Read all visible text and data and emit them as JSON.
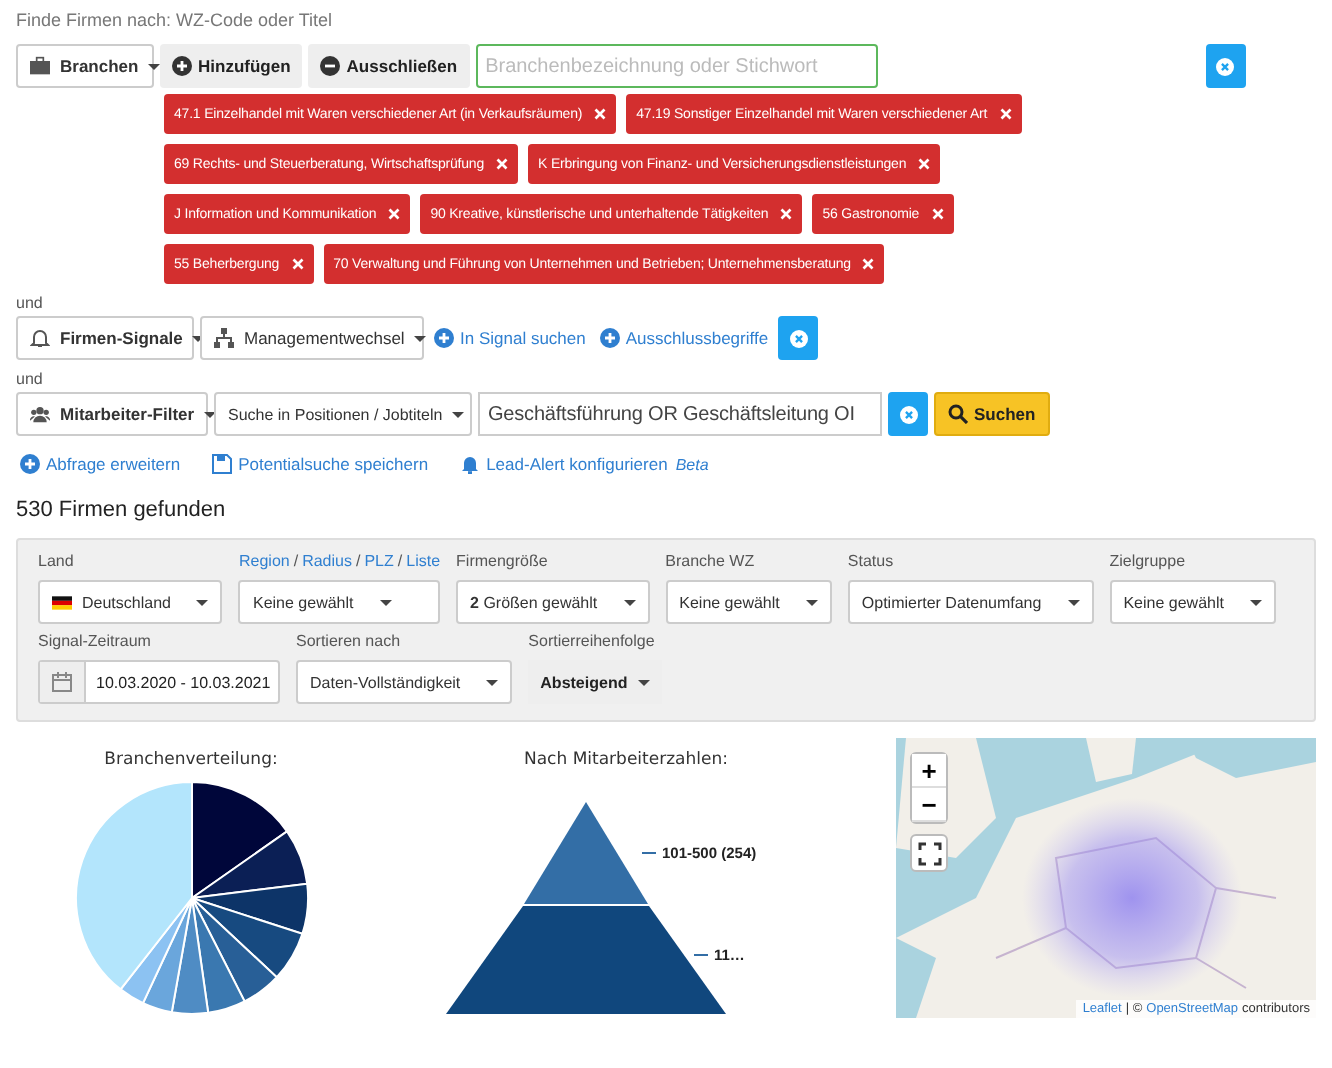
{
  "search_label": "Finde Firmen nach: WZ-Code oder Titel",
  "industry_row": {
    "category": "Branchen",
    "add_button": "Hinzufügen",
    "exclude_button": "Ausschließen",
    "search": {
      "placeholder": "Branchenbezeichnung oder Stichwort"
    }
  },
  "tags": [
    {
      "label": "47.1 Einzelhandel mit Waren verschiedener Art (in Verkaufsräumen)"
    },
    {
      "label": "47.19 Sonstiger Einzelhandel mit Waren verschiedener Art"
    },
    {
      "label": "69 Rechts- und Steuerberatung, Wirtschaftsprüfung"
    },
    {
      "label": "K Erbringung von Finanz- und Versicherungsdienstleistungen"
    },
    {
      "label": "J Information und Kommunikation"
    },
    {
      "label": "90 Kreative, künstlerische und unterhaltende Tätigkeiten"
    },
    {
      "label": "56 Gastronomie"
    },
    {
      "label": "55 Beherbergung"
    },
    {
      "label": "70 Verwaltung und Führung von Unternehmen und Betrieben; Unternehmensberatung"
    }
  ],
  "connector_1": "und",
  "signal_row": {
    "category": "Firmen-Signale",
    "signal": "Managementwechsel",
    "links": [
      "In Signal suchen",
      "Ausschlussbegriffe"
    ]
  },
  "connector_2": "und",
  "employee_row": {
    "category": "Mitarbeiter-Filter",
    "mode": "Suche in Positionen / Jobtiteln",
    "query": "Geschäftsführung OR Geschäftsleitung OI",
    "search_button": "Suchen"
  },
  "actions": [
    {
      "label": "Abfrage erweitern",
      "kind": "expand"
    },
    {
      "label": "Potentialsuche speichern",
      "kind": "save"
    },
    {
      "label": "Lead-Alert konfigurieren",
      "kind": "alert",
      "badge": "Beta"
    }
  ],
  "result_count": "530 Firmen gefunden",
  "filters": [
    {
      "kind": "country",
      "label": "Land",
      "value": "Deutschland"
    },
    {
      "kind": "select",
      "label_links": [
        "Region",
        "Radius",
        "PLZ",
        "Liste"
      ],
      "link_separator": "/",
      "value": "Keine gewählt"
    },
    {
      "kind": "select",
      "label": "Firmengröße",
      "value": "**2** Größen gewählt"
    },
    {
      "kind": "select",
      "label": "Branche WZ",
      "value": "Keine gewählt"
    },
    {
      "kind": "select",
      "label": "Status",
      "value": "Optimierter Datenumfang"
    },
    {
      "kind": "select",
      "label": "Zielgruppe",
      "value": "Keine gewählt"
    },
    {
      "kind": "date",
      "label": "Signal-Zeitraum",
      "value": "10.03.2020 - 10.03.2021"
    },
    {
      "kind": "select",
      "label": "Sortieren nach",
      "value": "Daten-Vollständigkeit"
    },
    {
      "kind": "toggle",
      "label": "Sortierreihenfolge",
      "value": "Absteigend"
    }
  ],
  "charts": {
    "pie_title": "Branchenverteilung:",
    "pyramid_title": "Nach Mitarbeiterzahlen:",
    "pyramid_labels": [
      "101-500 (254)",
      "11…"
    ]
  },
  "map": {
    "kind": "picture",
    "zoom_in": "+",
    "zoom_out": "−",
    "attribution": {
      "leaflet": "Leaflet",
      "separator": "| ©",
      "osm": "OpenStreetMap",
      "suffix": "contributors"
    }
  }
}
